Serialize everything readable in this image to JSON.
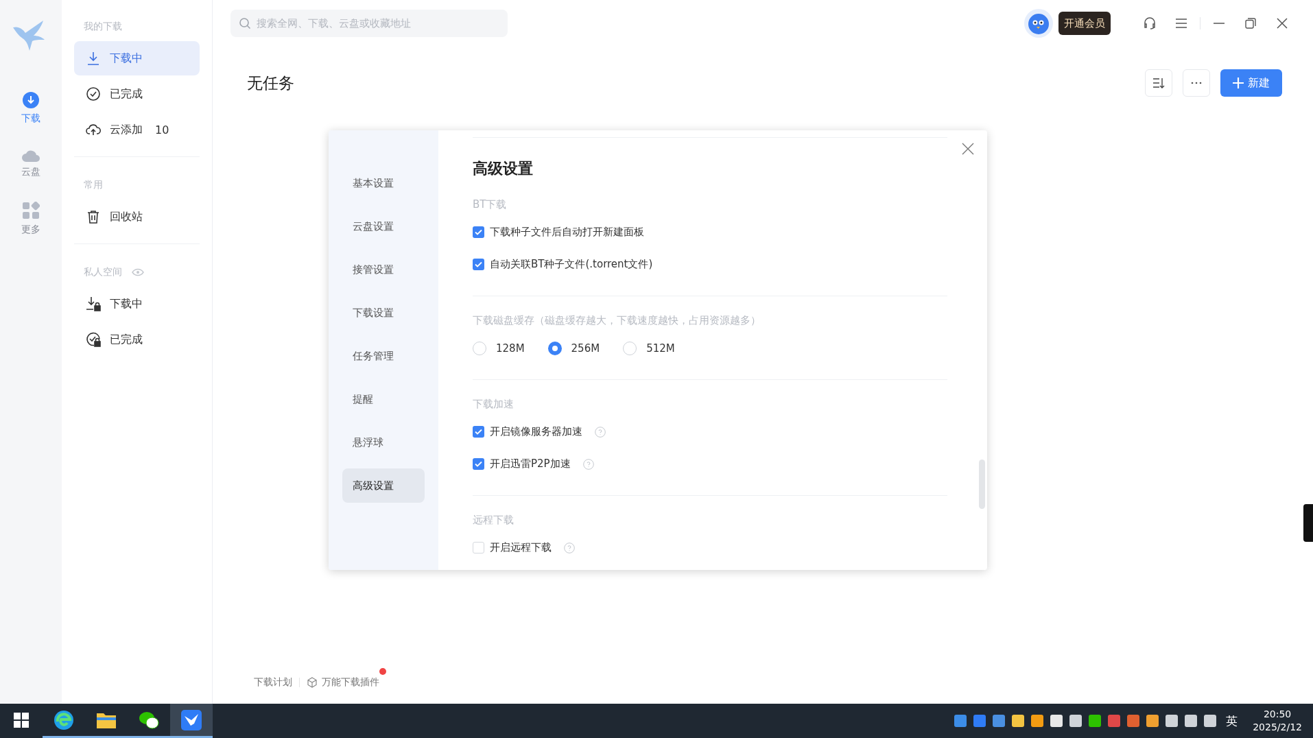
{
  "rail": {
    "items": [
      {
        "kind": "download",
        "label": "下载",
        "selected": true
      },
      {
        "kind": "cloud",
        "label": "云盘",
        "selected": false
      },
      {
        "kind": "more",
        "label": "更多",
        "selected": false
      }
    ]
  },
  "sidebar": {
    "sections": [
      {
        "title": "我的下载",
        "items": [
          {
            "kind": "download",
            "label": "下载中",
            "selected": true
          },
          {
            "kind": "done",
            "label": "已完成",
            "selected": false
          },
          {
            "kind": "cloud-add",
            "label": "云添加",
            "count": "10",
            "selected": false
          }
        ]
      },
      {
        "title": "常用",
        "items": [
          {
            "kind": "trash",
            "label": "回收站",
            "selected": false
          }
        ]
      },
      {
        "title": "私人空间",
        "eye": true,
        "items": [
          {
            "kind": "private-download",
            "label": "下载中",
            "selected": false
          },
          {
            "kind": "private-done",
            "label": "已完成",
            "selected": false
          }
        ]
      }
    ]
  },
  "search": {
    "placeholder": "搜索全网、下载、云盘或收藏地址"
  },
  "vip_button": "开通会员",
  "page_title": "无任务",
  "new_button": "新建",
  "dialog": {
    "nav": [
      {
        "label": "基本设置",
        "selected": false
      },
      {
        "label": "云盘设置",
        "selected": false
      },
      {
        "label": "接管设置",
        "selected": false
      },
      {
        "label": "下载设置",
        "selected": false
      },
      {
        "label": "任务管理",
        "selected": false
      },
      {
        "label": "提醒",
        "selected": false
      },
      {
        "label": "悬浮球",
        "selected": false
      },
      {
        "label": "高级设置",
        "selected": true
      }
    ],
    "title": "高级设置",
    "sections": [
      {
        "title": "BT下载",
        "options": [
          {
            "kind": "checkbox",
            "label": "下载种子文件后自动打开新建面板",
            "checked": true,
            "help": false
          },
          {
            "kind": "checkbox",
            "label": "自动关联BT种子文件(.torrent文件)",
            "checked": true,
            "help": false
          }
        ]
      },
      {
        "title": "下载磁盘缓存（磁盘缓存越大，下载速度越快，占用资源越多）",
        "options": [
          {
            "kind": "radio",
            "label": "128M",
            "selected": false
          },
          {
            "kind": "radio",
            "label": "256M",
            "selected": true
          },
          {
            "kind": "radio",
            "label": "512M",
            "selected": false
          }
        ]
      },
      {
        "title": "下载加速",
        "options": [
          {
            "kind": "checkbox",
            "label": "开启镜像服务器加速",
            "checked": true,
            "help": true
          },
          {
            "kind": "checkbox",
            "label": "开启迅雷P2P加速",
            "checked": true,
            "help": true
          }
        ]
      },
      {
        "title": "远程下载",
        "options": [
          {
            "kind": "checkbox",
            "label": "开启远程下载",
            "checked": false,
            "help": true
          }
        ]
      }
    ]
  },
  "footer": {
    "plan_link": "下载计划",
    "plugin": {
      "label": "万能下载插件",
      "notification": true
    }
  },
  "taskbar": {
    "apps": [
      {
        "kind": "browser",
        "selected": false
      },
      {
        "kind": "folder",
        "selected": false
      },
      {
        "kind": "chat",
        "selected": false
      },
      {
        "kind": "bird",
        "selected": true
      }
    ],
    "ime": "英",
    "time": "20:50",
    "date": "2025/2/12"
  }
}
